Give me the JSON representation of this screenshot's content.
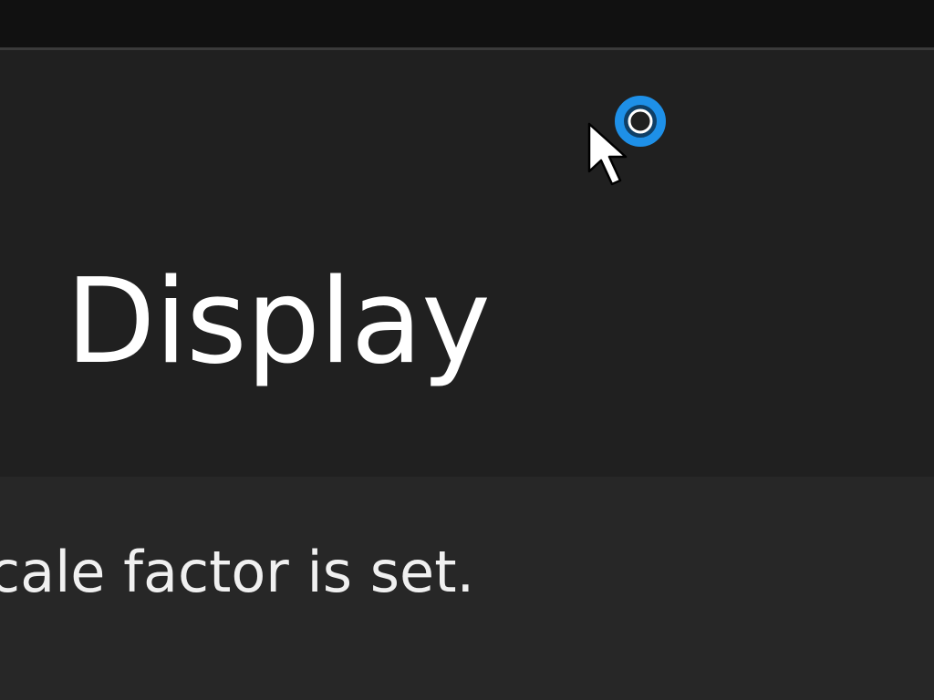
{
  "page": {
    "title": "Display"
  },
  "content": {
    "description_fragment": "cale factor is set."
  },
  "cursor": {
    "type": "busy-pointer",
    "spinner_color": "#1e90e8"
  },
  "colors": {
    "title_bar": "#111111",
    "header_background": "#202020",
    "content_background": "#272727",
    "text": "#ffffff"
  }
}
